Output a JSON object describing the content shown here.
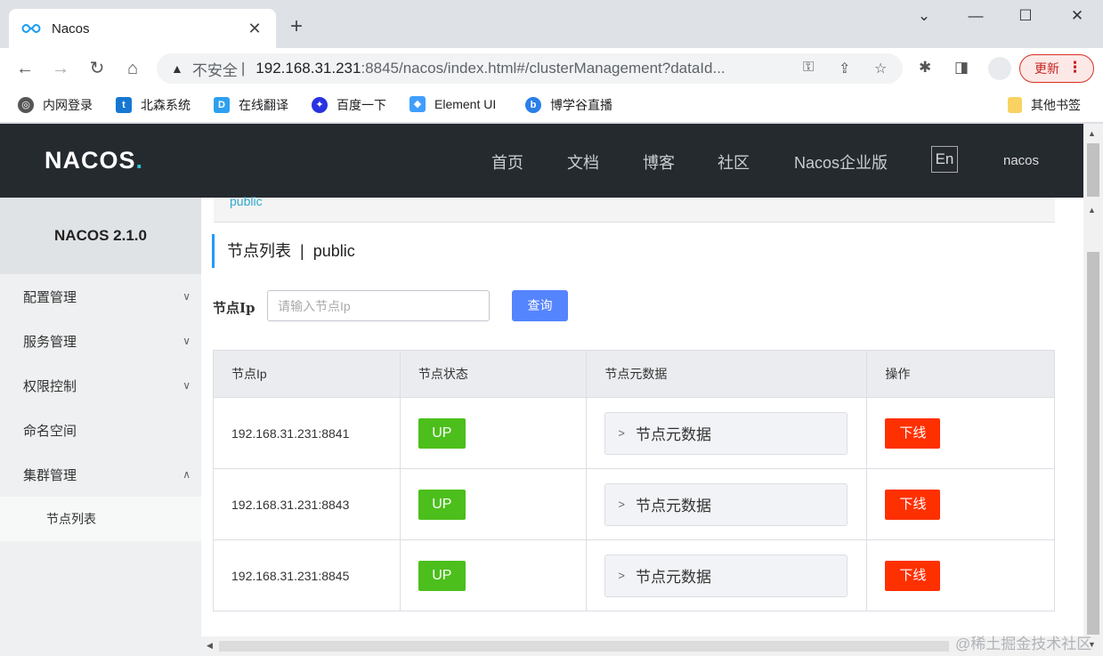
{
  "browser": {
    "tab_title": "Nacos",
    "new_tab": "+",
    "url_warning": "不安全",
    "url_separator": "|",
    "url_host": "192.168.31.231",
    "url_rest": ":8845/nacos/index.html#/clusterManagement?dataId...",
    "update_label": "更新",
    "bookmarks": [
      "内网登录",
      "北森系统",
      "在线翻译",
      "百度一下",
      "Element UI",
      "博学谷直播"
    ],
    "other_bookmarks": "其他书签"
  },
  "header": {
    "logo": "NACOS",
    "nav": [
      "首页",
      "文档",
      "博客",
      "社区",
      "Nacos企业版"
    ],
    "lang": "En",
    "user": "nacos"
  },
  "sidebar": {
    "title": "NACOS 2.1.0",
    "items": [
      "配置管理",
      "服务管理",
      "权限控制",
      "命名空间",
      "集群管理"
    ],
    "sub_item": "节点列表"
  },
  "main": {
    "breadcrumb": "public",
    "title": "节点列表",
    "title_sep": "|",
    "namespace": "public",
    "filter_label": "节点Ip",
    "filter_placeholder": "请输入节点Ip",
    "query_label": "查询",
    "columns": [
      "节点Ip",
      "节点状态",
      "节点元数据",
      "操作"
    ],
    "rows": [
      {
        "ip": "192.168.31.231:8841",
        "state": "UP",
        "meta": "节点元数据",
        "action": "下线"
      },
      {
        "ip": "192.168.31.231:8843",
        "state": "UP",
        "meta": "节点元数据",
        "action": "下线"
      },
      {
        "ip": "192.168.31.231:8845",
        "state": "UP",
        "meta": "节点元数据",
        "action": "下线"
      }
    ]
  },
  "watermark": "@稀土掘金技术社区",
  "colors": {
    "header_bg": "#252a2f",
    "up_badge": "#4cbf1c",
    "offline_btn": "#ff3000",
    "query_btn": "#5584ff"
  }
}
